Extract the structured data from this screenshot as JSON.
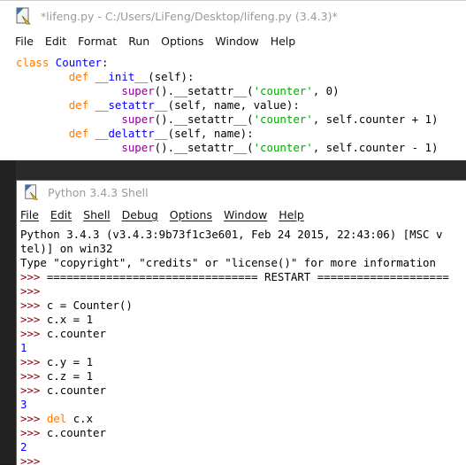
{
  "editor": {
    "title": "*lifeng.py - C:/Users/LiFeng/Desktop/lifeng.py (3.4.3)*",
    "menu": [
      "File",
      "Edit",
      "Format",
      "Run",
      "Options",
      "Window",
      "Help"
    ],
    "code": [
      [
        [
          "kw",
          "class"
        ],
        [
          "t",
          " "
        ],
        [
          "def",
          "Counter"
        ],
        [
          "t",
          ":"
        ]
      ],
      [
        [
          "t",
          "        "
        ],
        [
          "kw",
          "def"
        ],
        [
          "t",
          " "
        ],
        [
          "def",
          "__init__"
        ],
        [
          "t",
          "(self):"
        ]
      ],
      [
        [
          "t",
          "                "
        ],
        [
          "bi",
          "super"
        ],
        [
          "t",
          "().__setattr__("
        ],
        [
          "str",
          "'counter'"
        ],
        [
          "t",
          ", 0)"
        ]
      ],
      [
        [
          "t",
          "        "
        ],
        [
          "kw",
          "def"
        ],
        [
          "t",
          " "
        ],
        [
          "def",
          "__setattr__"
        ],
        [
          "t",
          "(self, name, value):"
        ]
      ],
      [
        [
          "t",
          "                "
        ],
        [
          "bi",
          "super"
        ],
        [
          "t",
          "().__setattr__("
        ],
        [
          "str",
          "'counter'"
        ],
        [
          "t",
          ", self.counter + 1)"
        ]
      ],
      [
        [
          "t",
          "        "
        ],
        [
          "kw",
          "def"
        ],
        [
          "t",
          " "
        ],
        [
          "def",
          "__delattr__"
        ],
        [
          "t",
          "(self, name):"
        ]
      ],
      [
        [
          "t",
          "                "
        ],
        [
          "bi",
          "super"
        ],
        [
          "t",
          "().__setattr__("
        ],
        [
          "str",
          "'counter'"
        ],
        [
          "t",
          ", self.counter - 1)"
        ]
      ]
    ]
  },
  "shell": {
    "title": "Python 3.4.3 Shell",
    "menu": [
      "File",
      "Edit",
      "Shell",
      "Debug",
      "Options",
      "Window",
      "Help"
    ],
    "lines": [
      [
        [
          "t",
          "Python 3.4.3 (v3.4.3:9b73f1c3e601, Feb 24 2015, 22:43:06) [MSC v"
        ]
      ],
      [
        [
          "t",
          "tel)] on win32"
        ]
      ],
      [
        [
          "t",
          "Type \"copyright\", \"credits\" or \"license()\" for more information"
        ]
      ],
      [
        [
          "pr",
          ">>> "
        ],
        [
          "t",
          "================================ RESTART ===================="
        ]
      ],
      [
        [
          "pr",
          ">>> "
        ]
      ],
      [
        [
          "pr",
          ">>> "
        ],
        [
          "t",
          "c = Counter()"
        ]
      ],
      [
        [
          "pr",
          ">>> "
        ],
        [
          "t",
          "c.x = 1"
        ]
      ],
      [
        [
          "pr",
          ">>> "
        ],
        [
          "t",
          "c.counter"
        ]
      ],
      [
        [
          "out",
          "1"
        ]
      ],
      [
        [
          "pr",
          ">>> "
        ],
        [
          "t",
          "c.y = 1"
        ]
      ],
      [
        [
          "pr",
          ">>> "
        ],
        [
          "t",
          "c.z = 1"
        ]
      ],
      [
        [
          "pr",
          ">>> "
        ],
        [
          "t",
          "c.counter"
        ]
      ],
      [
        [
          "out",
          "3"
        ]
      ],
      [
        [
          "pr",
          ">>> "
        ],
        [
          "kw",
          "del"
        ],
        [
          "t",
          " c.x"
        ]
      ],
      [
        [
          "pr",
          ">>> "
        ],
        [
          "t",
          "c.counter"
        ]
      ],
      [
        [
          "out",
          "2"
        ]
      ],
      [
        [
          "pr",
          ">>> "
        ]
      ]
    ]
  }
}
